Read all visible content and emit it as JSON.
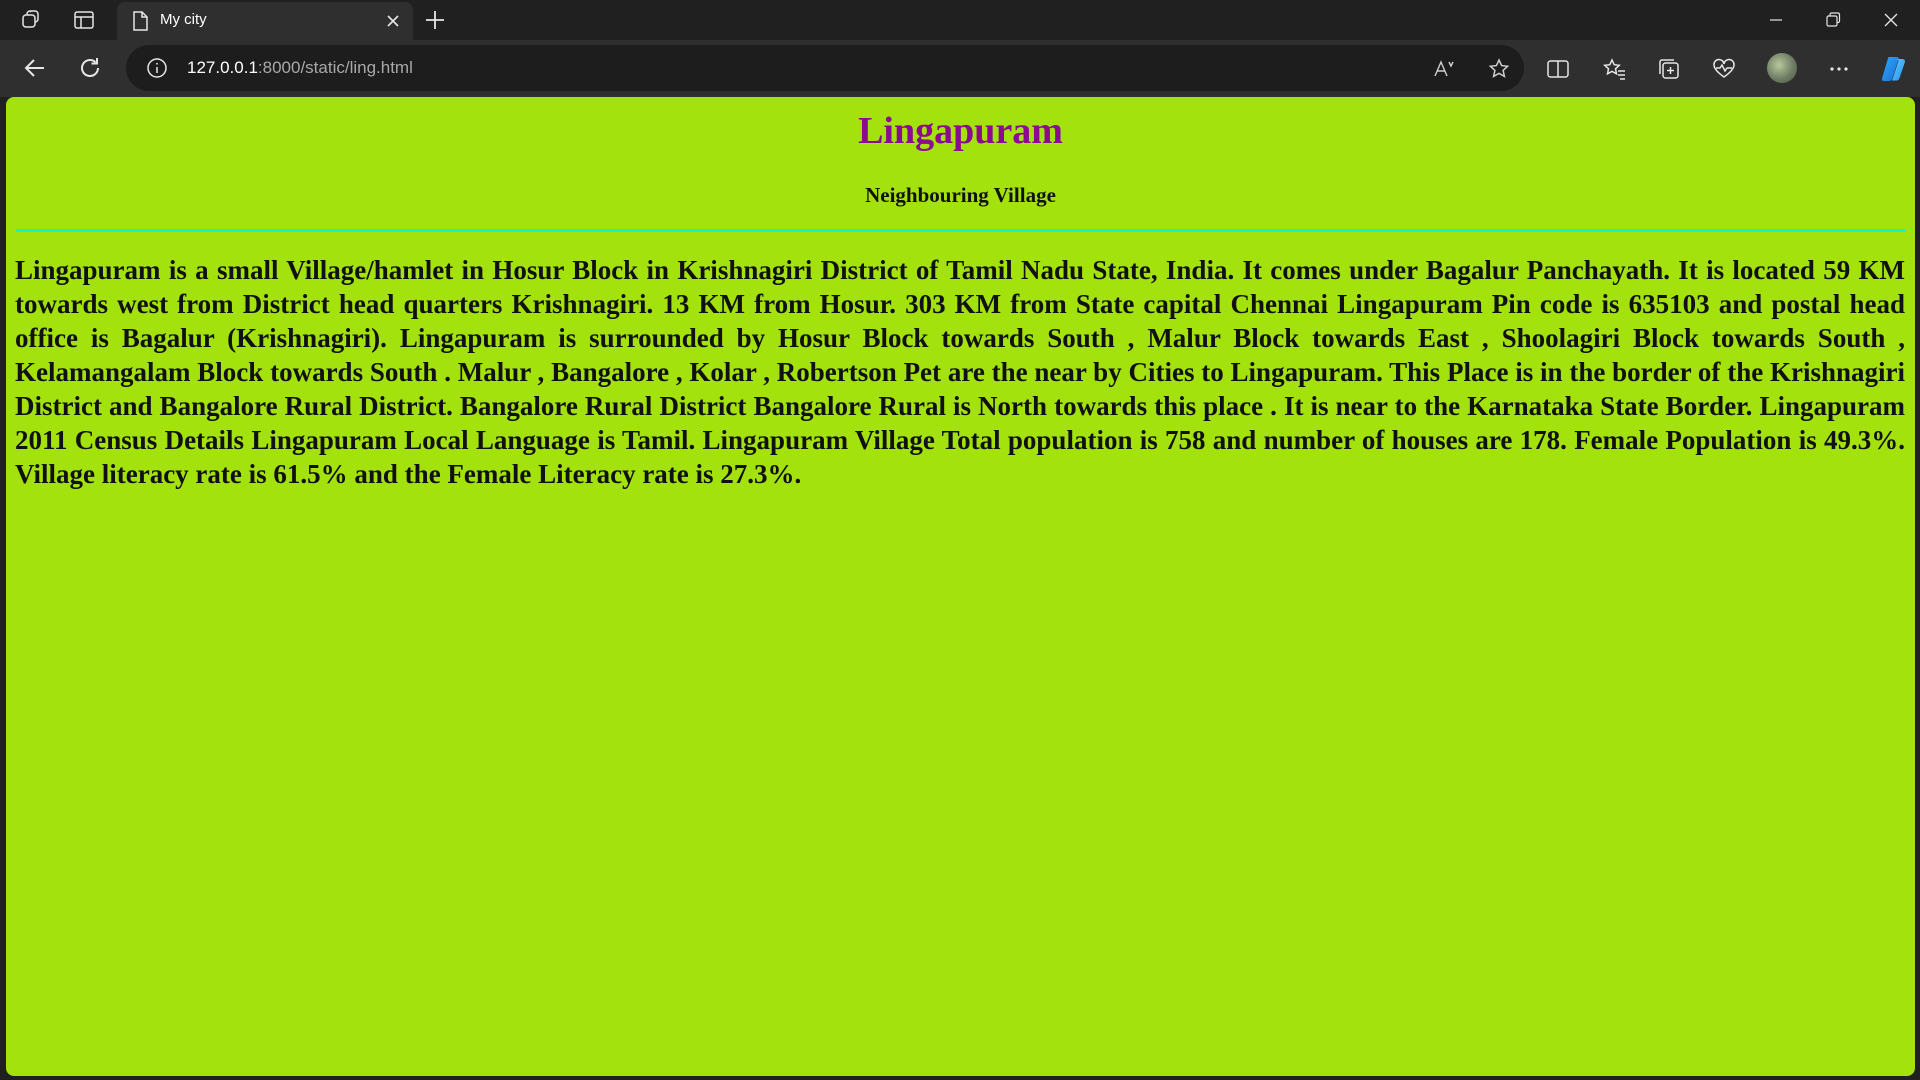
{
  "browser": {
    "tab": {
      "title": "My city"
    },
    "address_bar": {
      "host": "127.0.0.1",
      "path": ":8000/static/ling.html"
    }
  },
  "page": {
    "heading": "Lingapuram",
    "subheading": "Neighbouring Village",
    "paragraph": "Lingapuram is a small Village/hamlet in Hosur Block in Krishnagiri District of Tamil Nadu State, India. It comes under Bagalur Panchayath. It is located 59 KM towards west from District head quarters Krishnagiri. 13 KM from Hosur. 303 KM from State capital Chennai Lingapuram Pin code is 635103 and postal head office is Bagalur (Krishnagiri). Lingapuram is surrounded by Hosur Block towards South , Malur Block towards East , Shoolagiri Block towards South , Kelamangalam Block towards South . Malur , Bangalore , Kolar , Robertson Pet are the near by Cities to Lingapuram. This Place is in the border of the Krishnagiri District and Bangalore Rural District. Bangalore Rural District Bangalore Rural is North towards this place . It is near to the Karnataka State Border. Lingapuram 2011 Census Details Lingapuram Local Language is Tamil. Lingapuram Village Total population is 758 and number of houses are 178. Female Population is 49.3%. Village literacy rate is 61.5% and the Female Literacy rate is 27.3%."
  },
  "colors": {
    "page_background": "#a3e20d",
    "heading": "#8b0a8f",
    "rule": "#1ef0c8",
    "browser_chrome": "#202020",
    "toolbar": "#2f2f2f"
  },
  "icons": [
    "workspaces-icon",
    "tab-actions-icon",
    "page-icon",
    "close-tab-icon",
    "new-tab-icon",
    "minimize-icon",
    "restore-icon",
    "close-window-icon",
    "back-icon",
    "refresh-icon",
    "site-info-icon",
    "read-aloud-icon",
    "favorite-star-icon",
    "split-screen-icon",
    "favorites-icon",
    "collections-icon",
    "browser-essentials-icon",
    "profile-avatar",
    "more-menu-icon",
    "copilot-icon"
  ]
}
